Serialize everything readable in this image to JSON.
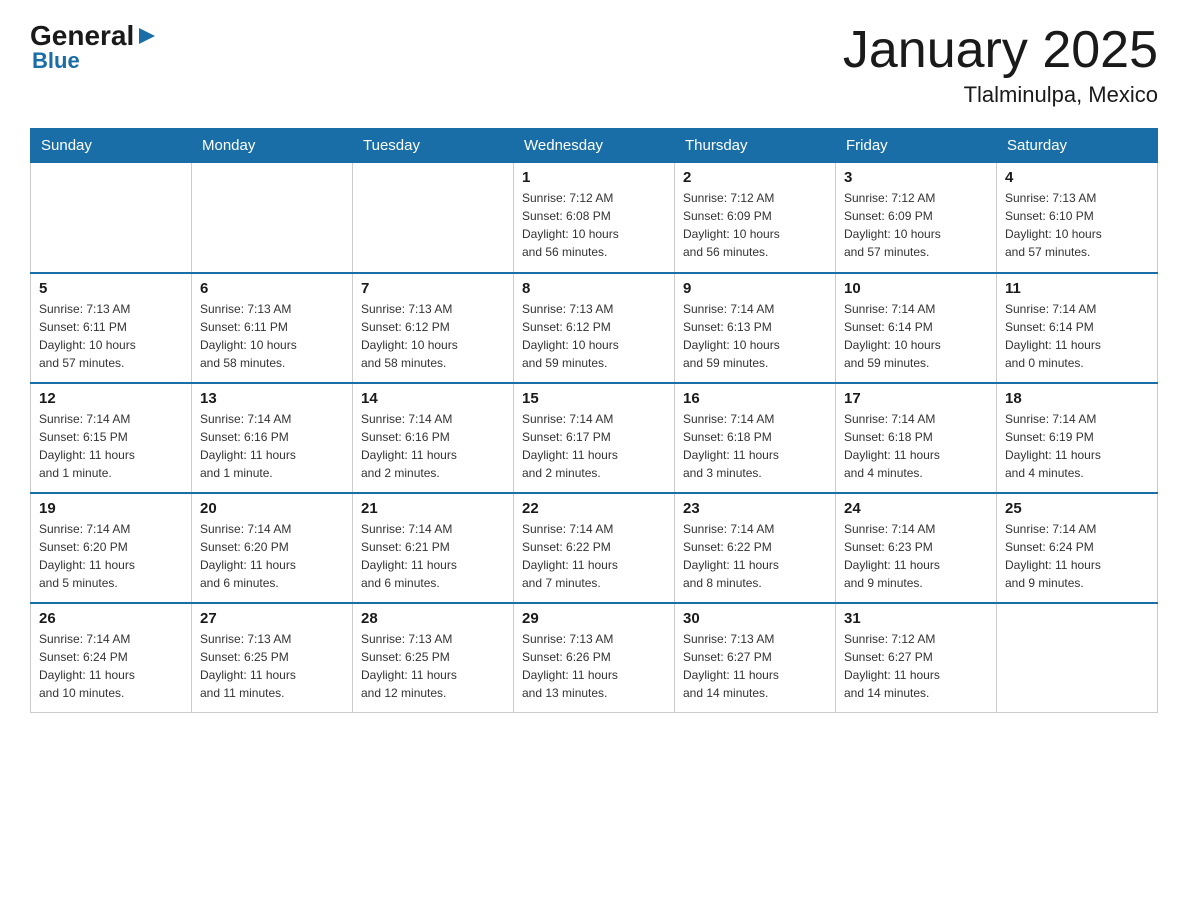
{
  "logo": {
    "general": "General",
    "blue": "Blue"
  },
  "title": "January 2025",
  "location": "Tlalminulpa, Mexico",
  "weekdays": [
    "Sunday",
    "Monday",
    "Tuesday",
    "Wednesday",
    "Thursday",
    "Friday",
    "Saturday"
  ],
  "weeks": [
    [
      {
        "day": "",
        "info": ""
      },
      {
        "day": "",
        "info": ""
      },
      {
        "day": "",
        "info": ""
      },
      {
        "day": "1",
        "info": "Sunrise: 7:12 AM\nSunset: 6:08 PM\nDaylight: 10 hours\nand 56 minutes."
      },
      {
        "day": "2",
        "info": "Sunrise: 7:12 AM\nSunset: 6:09 PM\nDaylight: 10 hours\nand 56 minutes."
      },
      {
        "day": "3",
        "info": "Sunrise: 7:12 AM\nSunset: 6:09 PM\nDaylight: 10 hours\nand 57 minutes."
      },
      {
        "day": "4",
        "info": "Sunrise: 7:13 AM\nSunset: 6:10 PM\nDaylight: 10 hours\nand 57 minutes."
      }
    ],
    [
      {
        "day": "5",
        "info": "Sunrise: 7:13 AM\nSunset: 6:11 PM\nDaylight: 10 hours\nand 57 minutes."
      },
      {
        "day": "6",
        "info": "Sunrise: 7:13 AM\nSunset: 6:11 PM\nDaylight: 10 hours\nand 58 minutes."
      },
      {
        "day": "7",
        "info": "Sunrise: 7:13 AM\nSunset: 6:12 PM\nDaylight: 10 hours\nand 58 minutes."
      },
      {
        "day": "8",
        "info": "Sunrise: 7:13 AM\nSunset: 6:12 PM\nDaylight: 10 hours\nand 59 minutes."
      },
      {
        "day": "9",
        "info": "Sunrise: 7:14 AM\nSunset: 6:13 PM\nDaylight: 10 hours\nand 59 minutes."
      },
      {
        "day": "10",
        "info": "Sunrise: 7:14 AM\nSunset: 6:14 PM\nDaylight: 10 hours\nand 59 minutes."
      },
      {
        "day": "11",
        "info": "Sunrise: 7:14 AM\nSunset: 6:14 PM\nDaylight: 11 hours\nand 0 minutes."
      }
    ],
    [
      {
        "day": "12",
        "info": "Sunrise: 7:14 AM\nSunset: 6:15 PM\nDaylight: 11 hours\nand 1 minute."
      },
      {
        "day": "13",
        "info": "Sunrise: 7:14 AM\nSunset: 6:16 PM\nDaylight: 11 hours\nand 1 minute."
      },
      {
        "day": "14",
        "info": "Sunrise: 7:14 AM\nSunset: 6:16 PM\nDaylight: 11 hours\nand 2 minutes."
      },
      {
        "day": "15",
        "info": "Sunrise: 7:14 AM\nSunset: 6:17 PM\nDaylight: 11 hours\nand 2 minutes."
      },
      {
        "day": "16",
        "info": "Sunrise: 7:14 AM\nSunset: 6:18 PM\nDaylight: 11 hours\nand 3 minutes."
      },
      {
        "day": "17",
        "info": "Sunrise: 7:14 AM\nSunset: 6:18 PM\nDaylight: 11 hours\nand 4 minutes."
      },
      {
        "day": "18",
        "info": "Sunrise: 7:14 AM\nSunset: 6:19 PM\nDaylight: 11 hours\nand 4 minutes."
      }
    ],
    [
      {
        "day": "19",
        "info": "Sunrise: 7:14 AM\nSunset: 6:20 PM\nDaylight: 11 hours\nand 5 minutes."
      },
      {
        "day": "20",
        "info": "Sunrise: 7:14 AM\nSunset: 6:20 PM\nDaylight: 11 hours\nand 6 minutes."
      },
      {
        "day": "21",
        "info": "Sunrise: 7:14 AM\nSunset: 6:21 PM\nDaylight: 11 hours\nand 6 minutes."
      },
      {
        "day": "22",
        "info": "Sunrise: 7:14 AM\nSunset: 6:22 PM\nDaylight: 11 hours\nand 7 minutes."
      },
      {
        "day": "23",
        "info": "Sunrise: 7:14 AM\nSunset: 6:22 PM\nDaylight: 11 hours\nand 8 minutes."
      },
      {
        "day": "24",
        "info": "Sunrise: 7:14 AM\nSunset: 6:23 PM\nDaylight: 11 hours\nand 9 minutes."
      },
      {
        "day": "25",
        "info": "Sunrise: 7:14 AM\nSunset: 6:24 PM\nDaylight: 11 hours\nand 9 minutes."
      }
    ],
    [
      {
        "day": "26",
        "info": "Sunrise: 7:14 AM\nSunset: 6:24 PM\nDaylight: 11 hours\nand 10 minutes."
      },
      {
        "day": "27",
        "info": "Sunrise: 7:13 AM\nSunset: 6:25 PM\nDaylight: 11 hours\nand 11 minutes."
      },
      {
        "day": "28",
        "info": "Sunrise: 7:13 AM\nSunset: 6:25 PM\nDaylight: 11 hours\nand 12 minutes."
      },
      {
        "day": "29",
        "info": "Sunrise: 7:13 AM\nSunset: 6:26 PM\nDaylight: 11 hours\nand 13 minutes."
      },
      {
        "day": "30",
        "info": "Sunrise: 7:13 AM\nSunset: 6:27 PM\nDaylight: 11 hours\nand 14 minutes."
      },
      {
        "day": "31",
        "info": "Sunrise: 7:12 AM\nSunset: 6:27 PM\nDaylight: 11 hours\nand 14 minutes."
      },
      {
        "day": "",
        "info": ""
      }
    ]
  ]
}
